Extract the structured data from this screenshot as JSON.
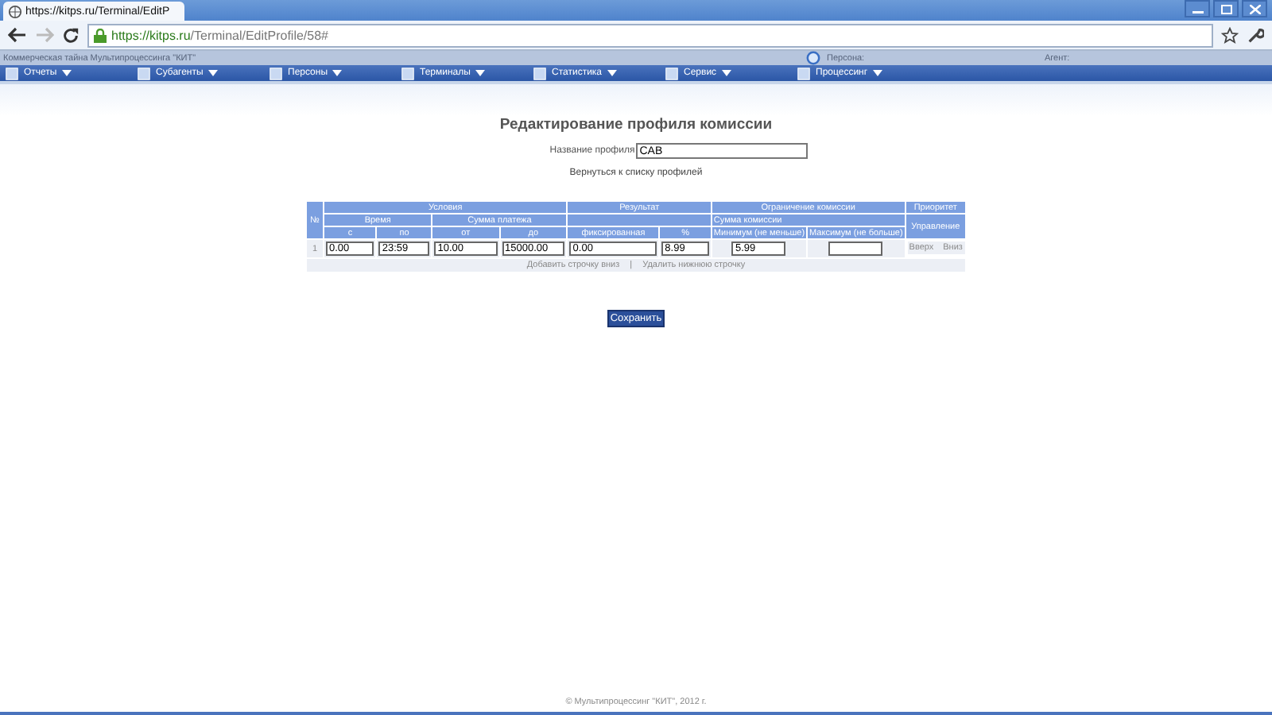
{
  "browser": {
    "tab_title": "https://kitps.ru/Terminal/EditP",
    "url_host": "https://kitps.ru",
    "url_path": "/Terminal/EditProfile/58#"
  },
  "info_bar": {
    "notice": "Коммерческая тайна Мультипроцессинга \"КИТ\"",
    "person_label": "Персона:",
    "agent_label": "Агент:"
  },
  "menu": [
    {
      "label": "Отчеты"
    },
    {
      "label": "Субагенты"
    },
    {
      "label": "Персоны"
    },
    {
      "label": "Терминалы"
    },
    {
      "label": "Статистика"
    },
    {
      "label": "Сервис"
    },
    {
      "label": "Процессинг"
    }
  ],
  "page": {
    "title": "Редактирование профиля комиссии",
    "name_label": "Название профиля",
    "name_value": "CAB",
    "back_link": "Вернуться к списку профилей"
  },
  "table": {
    "header_1": [
      "№",
      "Условия",
      "Результат",
      "Ограничение комиссии",
      "Приоритет"
    ],
    "header_2": [
      "Время",
      "Сумма платежа",
      "Сумма комиссии",
      "Управление"
    ],
    "header_3": [
      "с",
      "по",
      "от",
      "до",
      "фиксированная",
      "%",
      "Минимум (не меньше)",
      "Максимум (не больше)"
    ],
    "rows": [
      {
        "number": "1",
        "values": [
          "0.00",
          "23:59",
          "10.00",
          "15000.00",
          "0.00",
          "8.99",
          "5.99"
        ],
        "up": "Вверх",
        "down": "Вниз"
      }
    ],
    "add_link": "Добавить строчку вниз",
    "separator": "|",
    "remove_link": "Удалить нижнюю строчку"
  },
  "save_button": "Сохранить",
  "footer": "© Мультипроцессинг \"КИТ\", 2012 г."
}
